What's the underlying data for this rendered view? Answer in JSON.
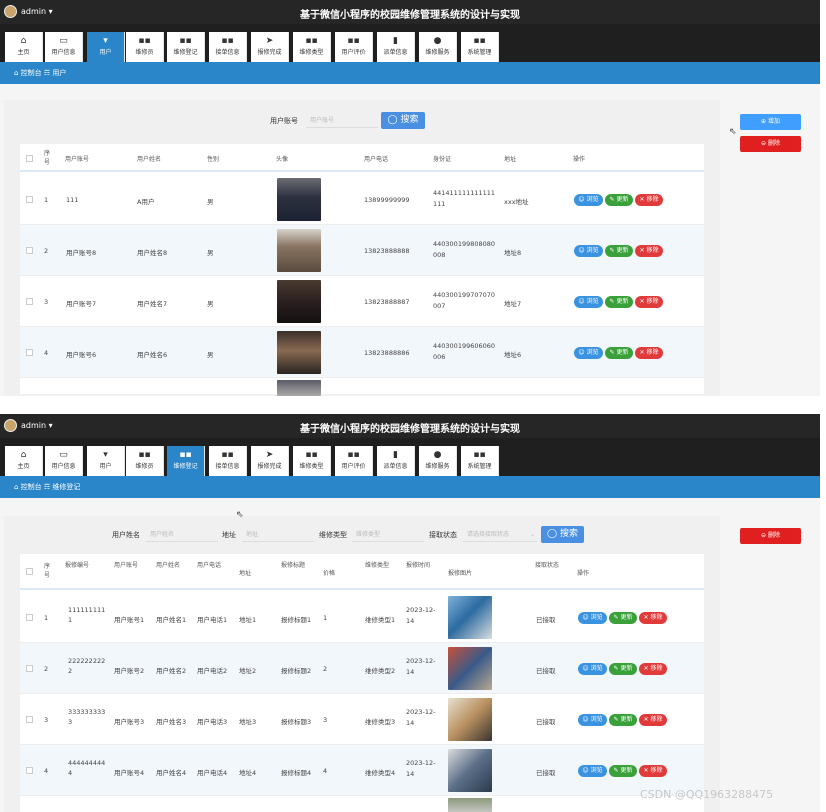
{
  "panel1": {
    "admin": "admin ▾",
    "title": "基于微信小程序的校园维修管理系统的设计与实现",
    "nav": [
      {
        "icon": "⌂",
        "label": "主页",
        "active": false
      },
      {
        "icon": "▭",
        "label": "用户信息",
        "active": false
      },
      {
        "icon": "▾",
        "label": "用户",
        "active": true
      },
      {
        "icon": "▪▪",
        "label": "维修员",
        "active": false
      },
      {
        "icon": "▪▪",
        "label": "维修登记",
        "active": false
      },
      {
        "icon": "▪▪",
        "label": "接单信息",
        "active": false
      },
      {
        "icon": "➤",
        "label": "报修完成",
        "active": false
      },
      {
        "icon": "▪▪",
        "label": "维修类型",
        "active": false
      },
      {
        "icon": "▪▪",
        "label": "用户评价",
        "active": false
      },
      {
        "icon": "▮",
        "label": "派单信息",
        "active": false
      },
      {
        "icon": "●",
        "label": "维修服务",
        "active": false
      },
      {
        "icon": "▪▪",
        "label": "系统管理",
        "active": false
      }
    ],
    "breadcrumb": "⌂ 控制台 ☶ 用户",
    "search": {
      "label": "用户账号",
      "placeholder": "用户账号",
      "button": "搜索"
    },
    "add_label": "⊕ 增加",
    "del_label": "⊖ 删除",
    "headers": [
      "序号",
      "用户账号",
      "用户姓名",
      "性别",
      "头像",
      "用户电话",
      "身份证",
      "地址",
      "操作"
    ],
    "rows": [
      {
        "no": "1",
        "account": "111",
        "name": "A用户",
        "gender": "男",
        "phone": "13899999999",
        "idcard": [
          "441411111111111",
          "111"
        ],
        "addr": "xxx地址"
      },
      {
        "no": "2",
        "account": "用户账号8",
        "name": "用户姓名8",
        "gender": "男",
        "phone": "13823888888",
        "idcard": [
          "440300199808080",
          "008"
        ],
        "addr": "地址8"
      },
      {
        "no": "3",
        "account": "用户账号7",
        "name": "用户姓名7",
        "gender": "男",
        "phone": "13823888887",
        "idcard": [
          "440300199707070",
          "007"
        ],
        "addr": "地址7"
      },
      {
        "no": "4",
        "account": "用户账号6",
        "name": "用户姓名6",
        "gender": "男",
        "phone": "13823888886",
        "idcard": [
          "440300199606060",
          "006"
        ],
        "addr": "地址6"
      }
    ],
    "actions": {
      "view": "☺ 浏览",
      "edit": "✎ 更新",
      "del": "✕ 移除"
    }
  },
  "panel2": {
    "admin": "admin ▾",
    "title": "基于微信小程序的校园维修管理系统的设计与实现",
    "nav": [
      {
        "icon": "⌂",
        "label": "主页",
        "active": false
      },
      {
        "icon": "▭",
        "label": "用户信息",
        "active": false
      },
      {
        "icon": "▾",
        "label": "用户",
        "active": false
      },
      {
        "icon": "▪▪",
        "label": "维修员",
        "active": false
      },
      {
        "icon": "▪▪",
        "label": "维修登记",
        "active": true
      },
      {
        "icon": "▪▪",
        "label": "接单信息",
        "active": false
      },
      {
        "icon": "➤",
        "label": "报修完成",
        "active": false
      },
      {
        "icon": "▪▪",
        "label": "维修类型",
        "active": false
      },
      {
        "icon": "▪▪",
        "label": "用户评价",
        "active": false
      },
      {
        "icon": "▮",
        "label": "派单信息",
        "active": false
      },
      {
        "icon": "●",
        "label": "维修服务",
        "active": false
      },
      {
        "icon": "▪▪",
        "label": "系统管理",
        "active": false
      }
    ],
    "breadcrumb": "⌂ 控制台 ☶ 维修登记",
    "filters": [
      {
        "label": "用户姓名",
        "placeholder": "用户姓名"
      },
      {
        "label": "地址",
        "placeholder": "地址"
      },
      {
        "label": "维修类型",
        "placeholder": "维修类型"
      },
      {
        "label": "接取状态",
        "placeholder": "请选择接取状态"
      }
    ],
    "search_button": "搜索",
    "del_label": "⊖ 删除",
    "headers": [
      "序号",
      "报修编号",
      "用户账号",
      "用户姓名",
      "用户电话",
      "地址",
      "报修标题",
      "价格",
      "维修类型",
      "报修时间",
      "报修图片",
      "接取状态",
      "操作"
    ],
    "rows": [
      {
        "no": "1",
        "code": [
          "111111111",
          "1"
        ],
        "account": "用户账号1",
        "name": "用户姓名1",
        "phone": "用户电话1",
        "addr": "地址1",
        "title": "报修标题1",
        "price": "1",
        "type": "维修类型1",
        "time": [
          "2023-12-",
          "14"
        ],
        "status": "已接取"
      },
      {
        "no": "2",
        "code": [
          "222222222",
          "2"
        ],
        "account": "用户账号2",
        "name": "用户姓名2",
        "phone": "用户电话2",
        "addr": "地址2",
        "title": "报修标题2",
        "price": "2",
        "type": "维修类型2",
        "time": [
          "2023-12-",
          "14"
        ],
        "status": "已接取"
      },
      {
        "no": "3",
        "code": [
          "333333333",
          "3"
        ],
        "account": "用户账号3",
        "name": "用户姓名3",
        "phone": "用户电话3",
        "addr": "地址3",
        "title": "报修标题3",
        "price": "3",
        "type": "维修类型3",
        "time": [
          "2023-12-",
          "14"
        ],
        "status": "已接取"
      },
      {
        "no": "4",
        "code": [
          "444444444",
          "4"
        ],
        "account": "用户账号4",
        "name": "用户姓名4",
        "phone": "用户电话4",
        "addr": "地址4",
        "title": "报修标题4",
        "price": "4",
        "type": "维修类型4",
        "time": [
          "2023-12-",
          "14"
        ],
        "status": "已接取"
      }
    ],
    "actions": {
      "view": "☺ 浏览",
      "edit": "✎ 更新",
      "del": "✕ 移除"
    }
  },
  "watermark": "CSDN @QQ1963288475"
}
